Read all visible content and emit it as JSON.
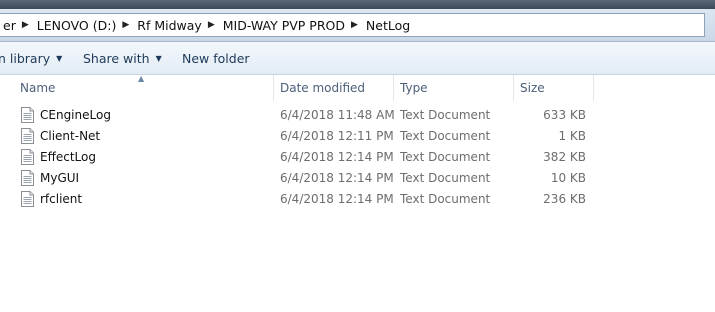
{
  "address": {
    "crumbs": [
      "er",
      "LENOVO (D:)",
      "Rf Midway",
      "MID-WAY PVP PROD",
      "NetLog"
    ]
  },
  "toolbar": {
    "include_label": "n library",
    "share_label": "Share with",
    "new_folder_label": "New folder"
  },
  "columns": {
    "name": "Name",
    "date": "Date modified",
    "type": "Type",
    "size": "Size"
  },
  "files": [
    {
      "name": "CEngineLog",
      "date": "6/4/2018 11:48 AM",
      "type": "Text Document",
      "size": "633 KB",
      "icon": "text-file-icon"
    },
    {
      "name": "Client-Net",
      "date": "6/4/2018 12:11 PM",
      "type": "Text Document",
      "size": "1 KB",
      "icon": "text-file-icon"
    },
    {
      "name": "EffectLog",
      "date": "6/4/2018 12:14 PM",
      "type": "Text Document",
      "size": "382 KB",
      "icon": "text-file-icon"
    },
    {
      "name": "MyGUI",
      "date": "6/4/2018 12:14 PM",
      "type": "Text Document",
      "size": "10 KB",
      "icon": "text-file-icon"
    },
    {
      "name": "rfclient",
      "date": "6/4/2018 12:14 PM",
      "type": "Text Document",
      "size": "236 KB",
      "icon": "text-file-icon"
    }
  ]
}
